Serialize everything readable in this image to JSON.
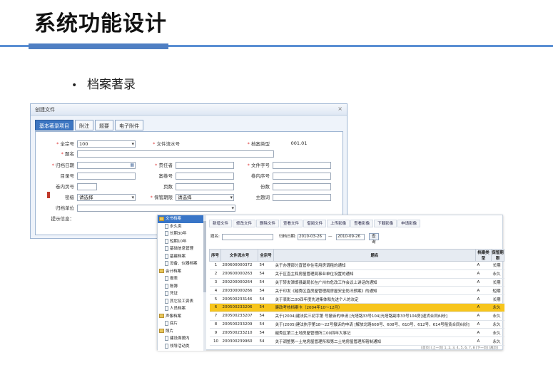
{
  "slide": {
    "title": "系统功能设计",
    "bullet": "档案著录"
  },
  "dialog": {
    "title": "创建文件",
    "close_icon": "×",
    "tabs": [
      "基本著录项目",
      "附注",
      "题要",
      "电子附件"
    ],
    "fields": {
      "quanzonghao": {
        "label": "全宗号",
        "value": "100"
      },
      "wenjianliushui": {
        "label": "文件流水号",
        "value": ""
      },
      "danganleixing": {
        "label": "档案类型",
        "value": "001.01"
      },
      "timing": {
        "label": "题名",
        "value": ""
      },
      "guidangriqi": {
        "label": "归档日期",
        "value": ""
      },
      "zerenzhe": {
        "label": "责任者",
        "value": ""
      },
      "wenjianzihao": {
        "label": "文件字号",
        "value": ""
      },
      "mulu": {
        "label": "目录号",
        "value": ""
      },
      "anjuan": {
        "label": "案卷号",
        "value": ""
      },
      "juanneixuhao": {
        "label": "卷内序号",
        "value": ""
      },
      "juanneiyehao": {
        "label": "卷内页号",
        "value": ""
      },
      "yeshu": {
        "label": "页数",
        "value": ""
      },
      "fenshu": {
        "label": "份数",
        "value": ""
      },
      "miji": {
        "label": "密级",
        "value": "请选择"
      },
      "baoguanqixian": {
        "label": "保管期限",
        "value": "请选择"
      },
      "zhutici": {
        "label": "主题词",
        "value": ""
      },
      "guidangdanwei": {
        "label": "归档单位",
        "value": ""
      },
      "tishi": {
        "label": "提示信息：",
        "value": ""
      }
    }
  },
  "manager": {
    "tree": [
      {
        "label": "文书档案",
        "type": "folder",
        "selected": true
      },
      {
        "label": "永久类",
        "type": "file"
      },
      {
        "label": "长期30年",
        "type": "file"
      },
      {
        "label": "短期10年",
        "type": "file"
      },
      {
        "label": "基础信息管理",
        "type": "file"
      },
      {
        "label": "基建档案",
        "type": "file"
      },
      {
        "label": "设备、仪器档案",
        "type": "file"
      },
      {
        "label": "会计档案",
        "type": "folder"
      },
      {
        "label": "报表",
        "type": "file"
      },
      {
        "label": "账簿",
        "type": "file"
      },
      {
        "label": "凭证",
        "type": "file"
      },
      {
        "label": "其它及工资表",
        "type": "file"
      },
      {
        "label": "人员档案",
        "type": "file"
      },
      {
        "label": "声像档案",
        "type": "folder"
      },
      {
        "label": "底片",
        "type": "file"
      },
      {
        "label": "照片",
        "type": "folder"
      },
      {
        "label": "建设面貌内",
        "type": "file"
      },
      {
        "label": "领导活动类",
        "type": "file"
      }
    ],
    "toolbar": [
      "新增文件",
      "修改文件",
      "删除文件",
      "查看文件",
      "借阅文件",
      "上传影像",
      "查看影像",
      "下载影像",
      "申请影像"
    ],
    "filter": {
      "title_label": "题名:",
      "date_label": "归档日期:",
      "date_from": "2010-03-26",
      "date_sep": "—",
      "date_to": "2010-09-26",
      "search": "查询"
    },
    "columns": [
      "序号",
      "文件流水号",
      "全宗号",
      "题名",
      "档案类型",
      "保管期限"
    ],
    "rows": [
      [
        "1",
        "200600000372",
        "54",
        "关于办理部分直管非住宅用房调租的通知",
        "A",
        "长期"
      ],
      [
        "2",
        "200600000263",
        "54",
        "关于区直主和房屋管理局事业单位设置的通知",
        "A",
        "永久"
      ],
      [
        "3",
        "200200000264",
        "54",
        "关于转发潭邯县副局长在广州市危改工作会议上讲话的通知",
        "A",
        "长期"
      ],
      [
        "4",
        "200300000266",
        "54",
        "关于印发《越秀区直房屋管理局房屋安全防汛预案》的通知",
        "A",
        "短期"
      ],
      [
        "5",
        "200500233146",
        "54",
        "关于表彰二00四年度先进集体和先进个人的决定",
        "A",
        "长期"
      ],
      [
        "6",
        "200500233206",
        "54",
        "廉政考核档案卡（2004年10～12月）",
        "A",
        "永久"
      ],
      [
        "7",
        "200500233207",
        "54",
        "关于(2004)建法民三初字第 号撤诉的申请 [光塔路33号104]光塔路副本33号104房]退货合同纠纷]",
        "A",
        "永久"
      ],
      [
        "8",
        "200500233209",
        "54",
        "关于(2005)建法执字第18～22号撤诉的申请 [解放北路608号、608号、610号、612号、614号租赁合同纠纷]",
        "A",
        "永久"
      ],
      [
        "9",
        "200500233210",
        "54",
        "越秀区第二土地房屋管理所二00四年大事记",
        "A",
        "永久"
      ],
      [
        "10",
        "200300239960",
        "54",
        "关于调整第一土地房屋管理所和第二土地房屋管理所辖制通知",
        "A",
        "永久"
      ]
    ],
    "highlight_row": 5,
    "pager": "[首页] [上一页] 1, 2, 3, 4, 5, 6, 7, 8 [下一页] [尾页]"
  },
  "colors": {
    "accent": "#4f7fc3",
    "tab_active": "#3d76c2",
    "highlight": "#f7c51c"
  }
}
